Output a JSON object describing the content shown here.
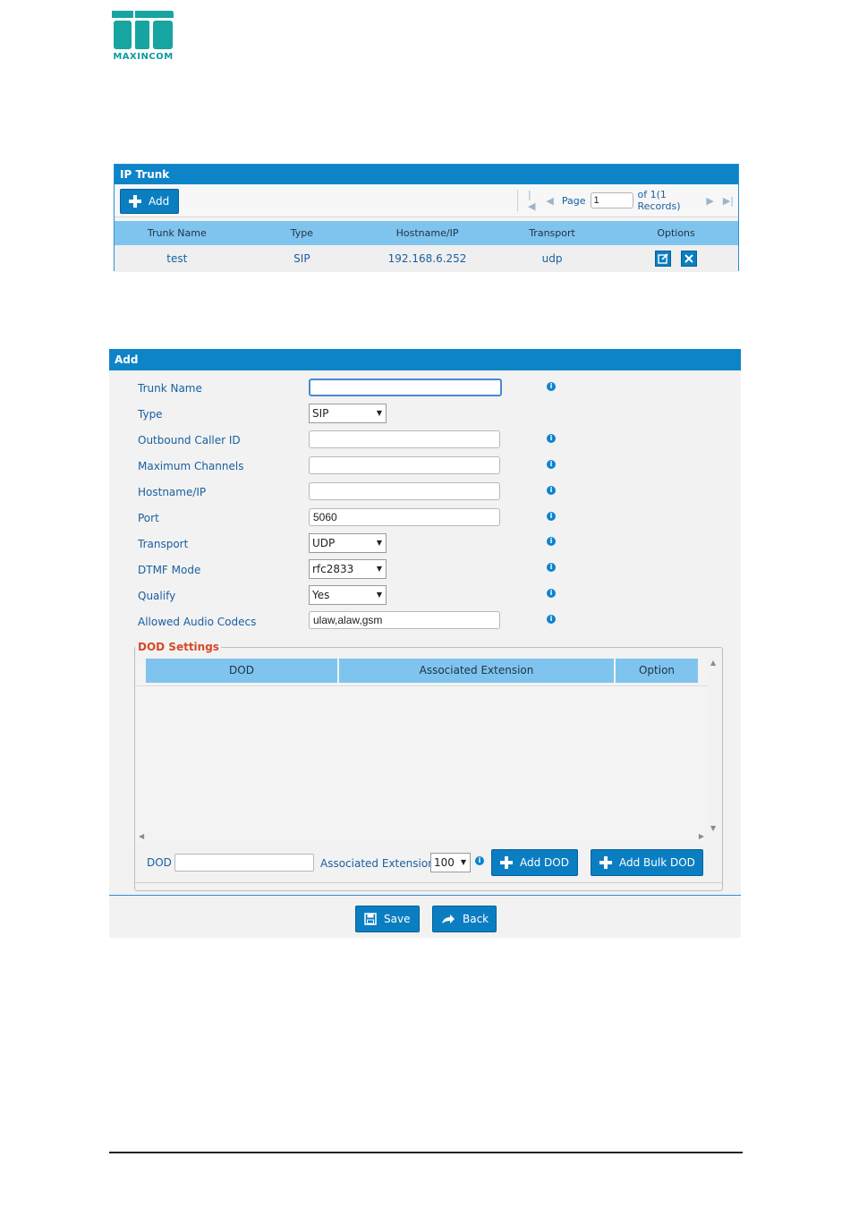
{
  "logo": {
    "text": "MAXINCOM"
  },
  "ip_trunk": {
    "title": "IP Trunk",
    "add_label": "Add",
    "pager": {
      "page_label": "Page",
      "page_value": "1",
      "of_text": "of 1(1 Records)"
    },
    "columns": [
      "Trunk Name",
      "Type",
      "Hostname/IP",
      "Transport",
      "Options"
    ],
    "rows": [
      {
        "name": "test",
        "type": "SIP",
        "host": "192.168.6.252",
        "transport": "udp"
      }
    ]
  },
  "add_form": {
    "title": "Add",
    "fields": {
      "trunk_name": {
        "label": "Trunk Name",
        "value": ""
      },
      "type": {
        "label": "Type",
        "value": "SIP"
      },
      "outbound_caller_id": {
        "label": "Outbound Caller ID",
        "value": ""
      },
      "maximum_channels": {
        "label": "Maximum Channels",
        "value": ""
      },
      "hostname_ip": {
        "label": "Hostname/IP",
        "value": ""
      },
      "port": {
        "label": "Port",
        "value": "5060"
      },
      "transport": {
        "label": "Transport",
        "value": "UDP"
      },
      "dtmf_mode": {
        "label": "DTMF Mode",
        "value": "rfc2833"
      },
      "qualify": {
        "label": "Qualify",
        "value": "Yes"
      },
      "allowed_audio_codecs": {
        "label": "Allowed Audio Codecs",
        "value": "ulaw,alaw,gsm"
      }
    },
    "dod": {
      "legend": "DOD Settings",
      "columns": [
        "DOD",
        "Associated Extension",
        "Option"
      ],
      "dod_label": "DOD",
      "dod_value": "",
      "assoc_label": "Associated Extension",
      "assoc_value": "100",
      "add_dod_label": "Add DOD",
      "add_bulk_label": "Add Bulk DOD"
    },
    "save_label": "Save",
    "back_label": "Back"
  },
  "colors": {
    "header_blue": "#0d84c8",
    "table_head": "#7fc4ef",
    "legend_red": "#d64a28"
  }
}
